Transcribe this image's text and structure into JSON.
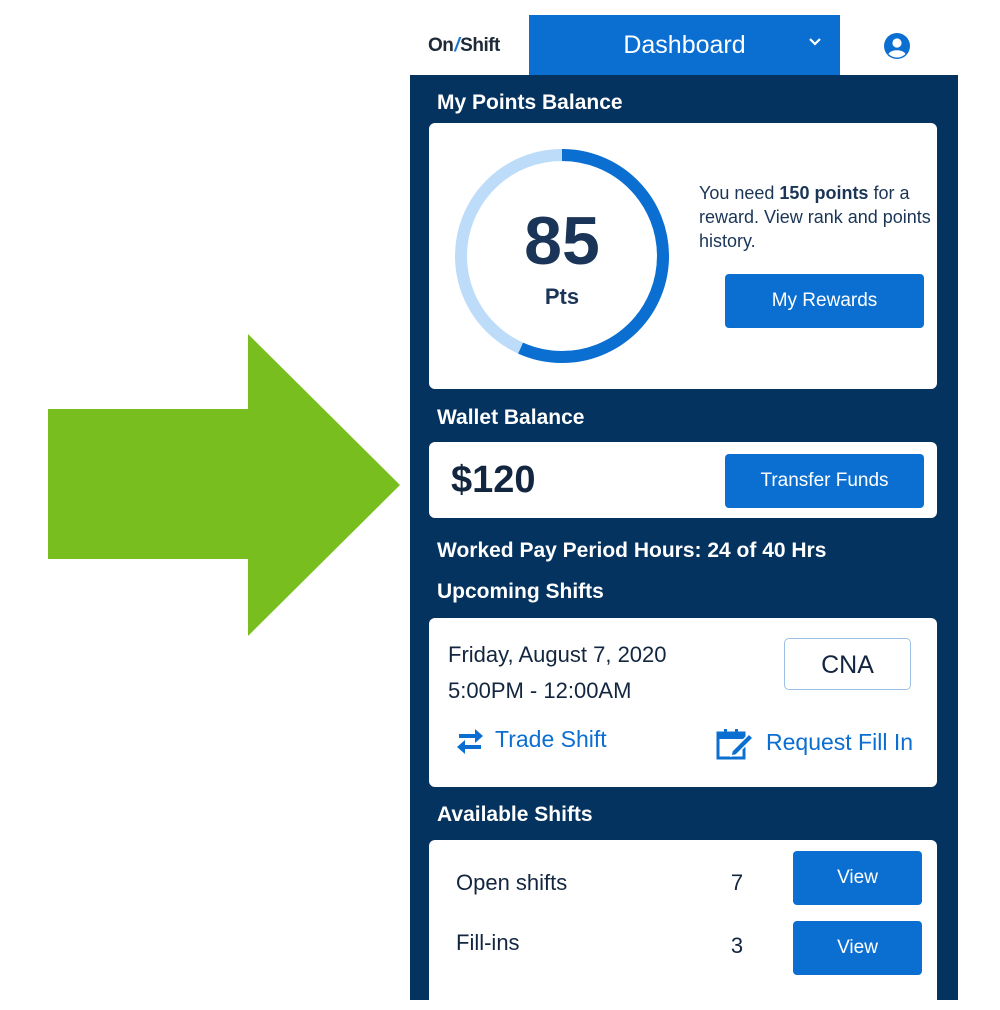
{
  "header": {
    "logo_on": "On",
    "logo_slash": "/",
    "logo_shift": "Shift",
    "nav_label": "Dashboard",
    "chevron_icon": "chevron-down-icon",
    "account_icon": "user-circle-icon"
  },
  "points": {
    "title": "My Points Balance",
    "value": "85",
    "unit": "Pts",
    "progress_fraction": 0.567,
    "message_pre": "You need ",
    "message_bold": "150 points",
    "message_post": " for a reward. View rank and points history.",
    "button": "My Rewards"
  },
  "wallet": {
    "title": "Wallet Balance",
    "amount": "$120",
    "button": "Transfer Funds"
  },
  "hours": {
    "text": "Worked Pay Period Hours: 24 of 40 Hrs"
  },
  "upcoming": {
    "title": "Upcoming Shifts",
    "date": "Friday, August 7, 2020",
    "time": "5:00PM - 12:00AM",
    "role": "CNA",
    "trade_label": "Trade Shift",
    "trade_icon": "swap-arrows-icon",
    "fillin_label": "Request Fill In",
    "fillin_icon": "calendar-edit-icon"
  },
  "available": {
    "title": "Available Shifts",
    "rows": [
      {
        "label": "Open shifts",
        "count": "7",
        "button": "View"
      },
      {
        "label": "Fill-ins",
        "count": "3",
        "button": "View"
      }
    ]
  },
  "colors": {
    "accent": "#0b6fd2",
    "panel": "#05335f",
    "arrow": "#77be1e",
    "ring_track": "#bcdcf9"
  }
}
